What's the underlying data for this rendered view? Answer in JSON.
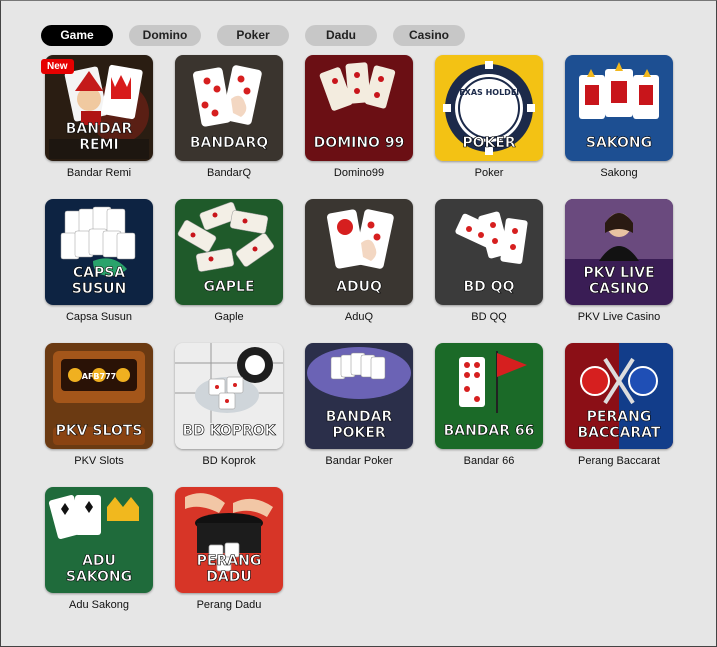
{
  "tabs": [
    {
      "label": "Game",
      "active": true
    },
    {
      "label": "Domino",
      "active": false
    },
    {
      "label": "Poker",
      "active": false
    },
    {
      "label": "Dadu",
      "active": false
    },
    {
      "label": "Casino",
      "active": false
    }
  ],
  "badge_new": "New",
  "games": [
    {
      "name": "Bandar Remi",
      "logo": "BANDAR REMI",
      "icon": "jester-cards-icon"
    },
    {
      "name": "BandarQ",
      "logo": "BANDARQ",
      "icon": "domino-hand-icon"
    },
    {
      "name": "Domino99",
      "logo": "DOMINO 99",
      "icon": "domino-tiles-icon"
    },
    {
      "name": "Poker",
      "logo": "POKER",
      "sublogo": "TEXAS HOLDEM",
      "icon": "poker-chip-icon"
    },
    {
      "name": "Sakong",
      "logo": "SAKONG",
      "icon": "king-cards-icon"
    },
    {
      "name": "Capsa Susun",
      "logo": "CAPSA SUSUN",
      "icon": "dragon-cards-icon"
    },
    {
      "name": "Gaple",
      "logo": "GAPLE",
      "icon": "domino-chain-icon"
    },
    {
      "name": "AduQ",
      "logo": "ADUQ",
      "icon": "domino-hand-icon"
    },
    {
      "name": "BD QQ",
      "logo": "BD QQ",
      "icon": "domino-pair-icon"
    },
    {
      "name": "PKV Live Casino",
      "logo": "PKV LIVE CASINO",
      "icon": "live-dealer-icon"
    },
    {
      "name": "PKV Slots",
      "logo": "PKV SLOTS",
      "sublogo": "AFB777",
      "icon": "slot-machine-icon"
    },
    {
      "name": "BD Koprok",
      "logo": "BD KOPROK",
      "icon": "dice-bowl-icon"
    },
    {
      "name": "Bandar Poker",
      "logo": "BANDAR POKER",
      "icon": "royal-flush-icon"
    },
    {
      "name": "Bandar 66",
      "logo": "BANDAR 66",
      "icon": "domino-flag-icon"
    },
    {
      "name": "Perang Baccarat",
      "logo": "PERANG BACCARAT",
      "icon": "crossed-swords-icon"
    },
    {
      "name": "Adu Sakong",
      "logo": "ADU SAKONG",
      "icon": "crown-cards-icon"
    },
    {
      "name": "Perang Dadu",
      "logo": "PERANG DADU",
      "icon": "dice-cup-icon"
    }
  ]
}
